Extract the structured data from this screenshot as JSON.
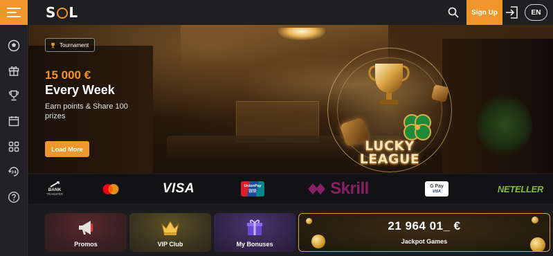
{
  "header": {
    "logo": "SOL",
    "signup_label": "Sign Up",
    "lang_label": "EN"
  },
  "sidebar": {
    "items": [
      {
        "icon": "football-icon"
      },
      {
        "icon": "gift-icon"
      },
      {
        "icon": "trophy-icon"
      },
      {
        "icon": "calendar-icon"
      },
      {
        "icon": "grid-icon"
      },
      {
        "icon": "support-24-icon"
      },
      {
        "icon": "help-icon"
      }
    ]
  },
  "hero": {
    "badge_label": "Tournament",
    "amount": "15 000 €",
    "headline": "Every Week",
    "subline": "Earn points & Share 100 prizes",
    "cta_label": "Load More",
    "league_line1": "LUCKY",
    "league_line2": "LEAGUE"
  },
  "payments": {
    "bank_line1": "BANK",
    "bank_line2": "TRANSFER",
    "visa": "VISA",
    "unionpay_line1": "UnionPay",
    "unionpay_line2": "银联",
    "skrill": "Skrill",
    "gpay": "G Pay",
    "gpay_sub": "VISA",
    "neteller": "NETELLER"
  },
  "cards": {
    "promos_label": "Promos",
    "vip_label": "VIP Club",
    "bonuses_label": "My Bonuses",
    "jackpot_amount": "21 964 01_ €",
    "jackpot_label": "Jackpot Games"
  },
  "colors": {
    "accent": "#f0962a",
    "background": "#1c1c1e",
    "skrill": "#862165",
    "neteller": "#83ba3b",
    "mastercard_red": "#eb001b",
    "mastercard_orange": "#f79e1b"
  }
}
